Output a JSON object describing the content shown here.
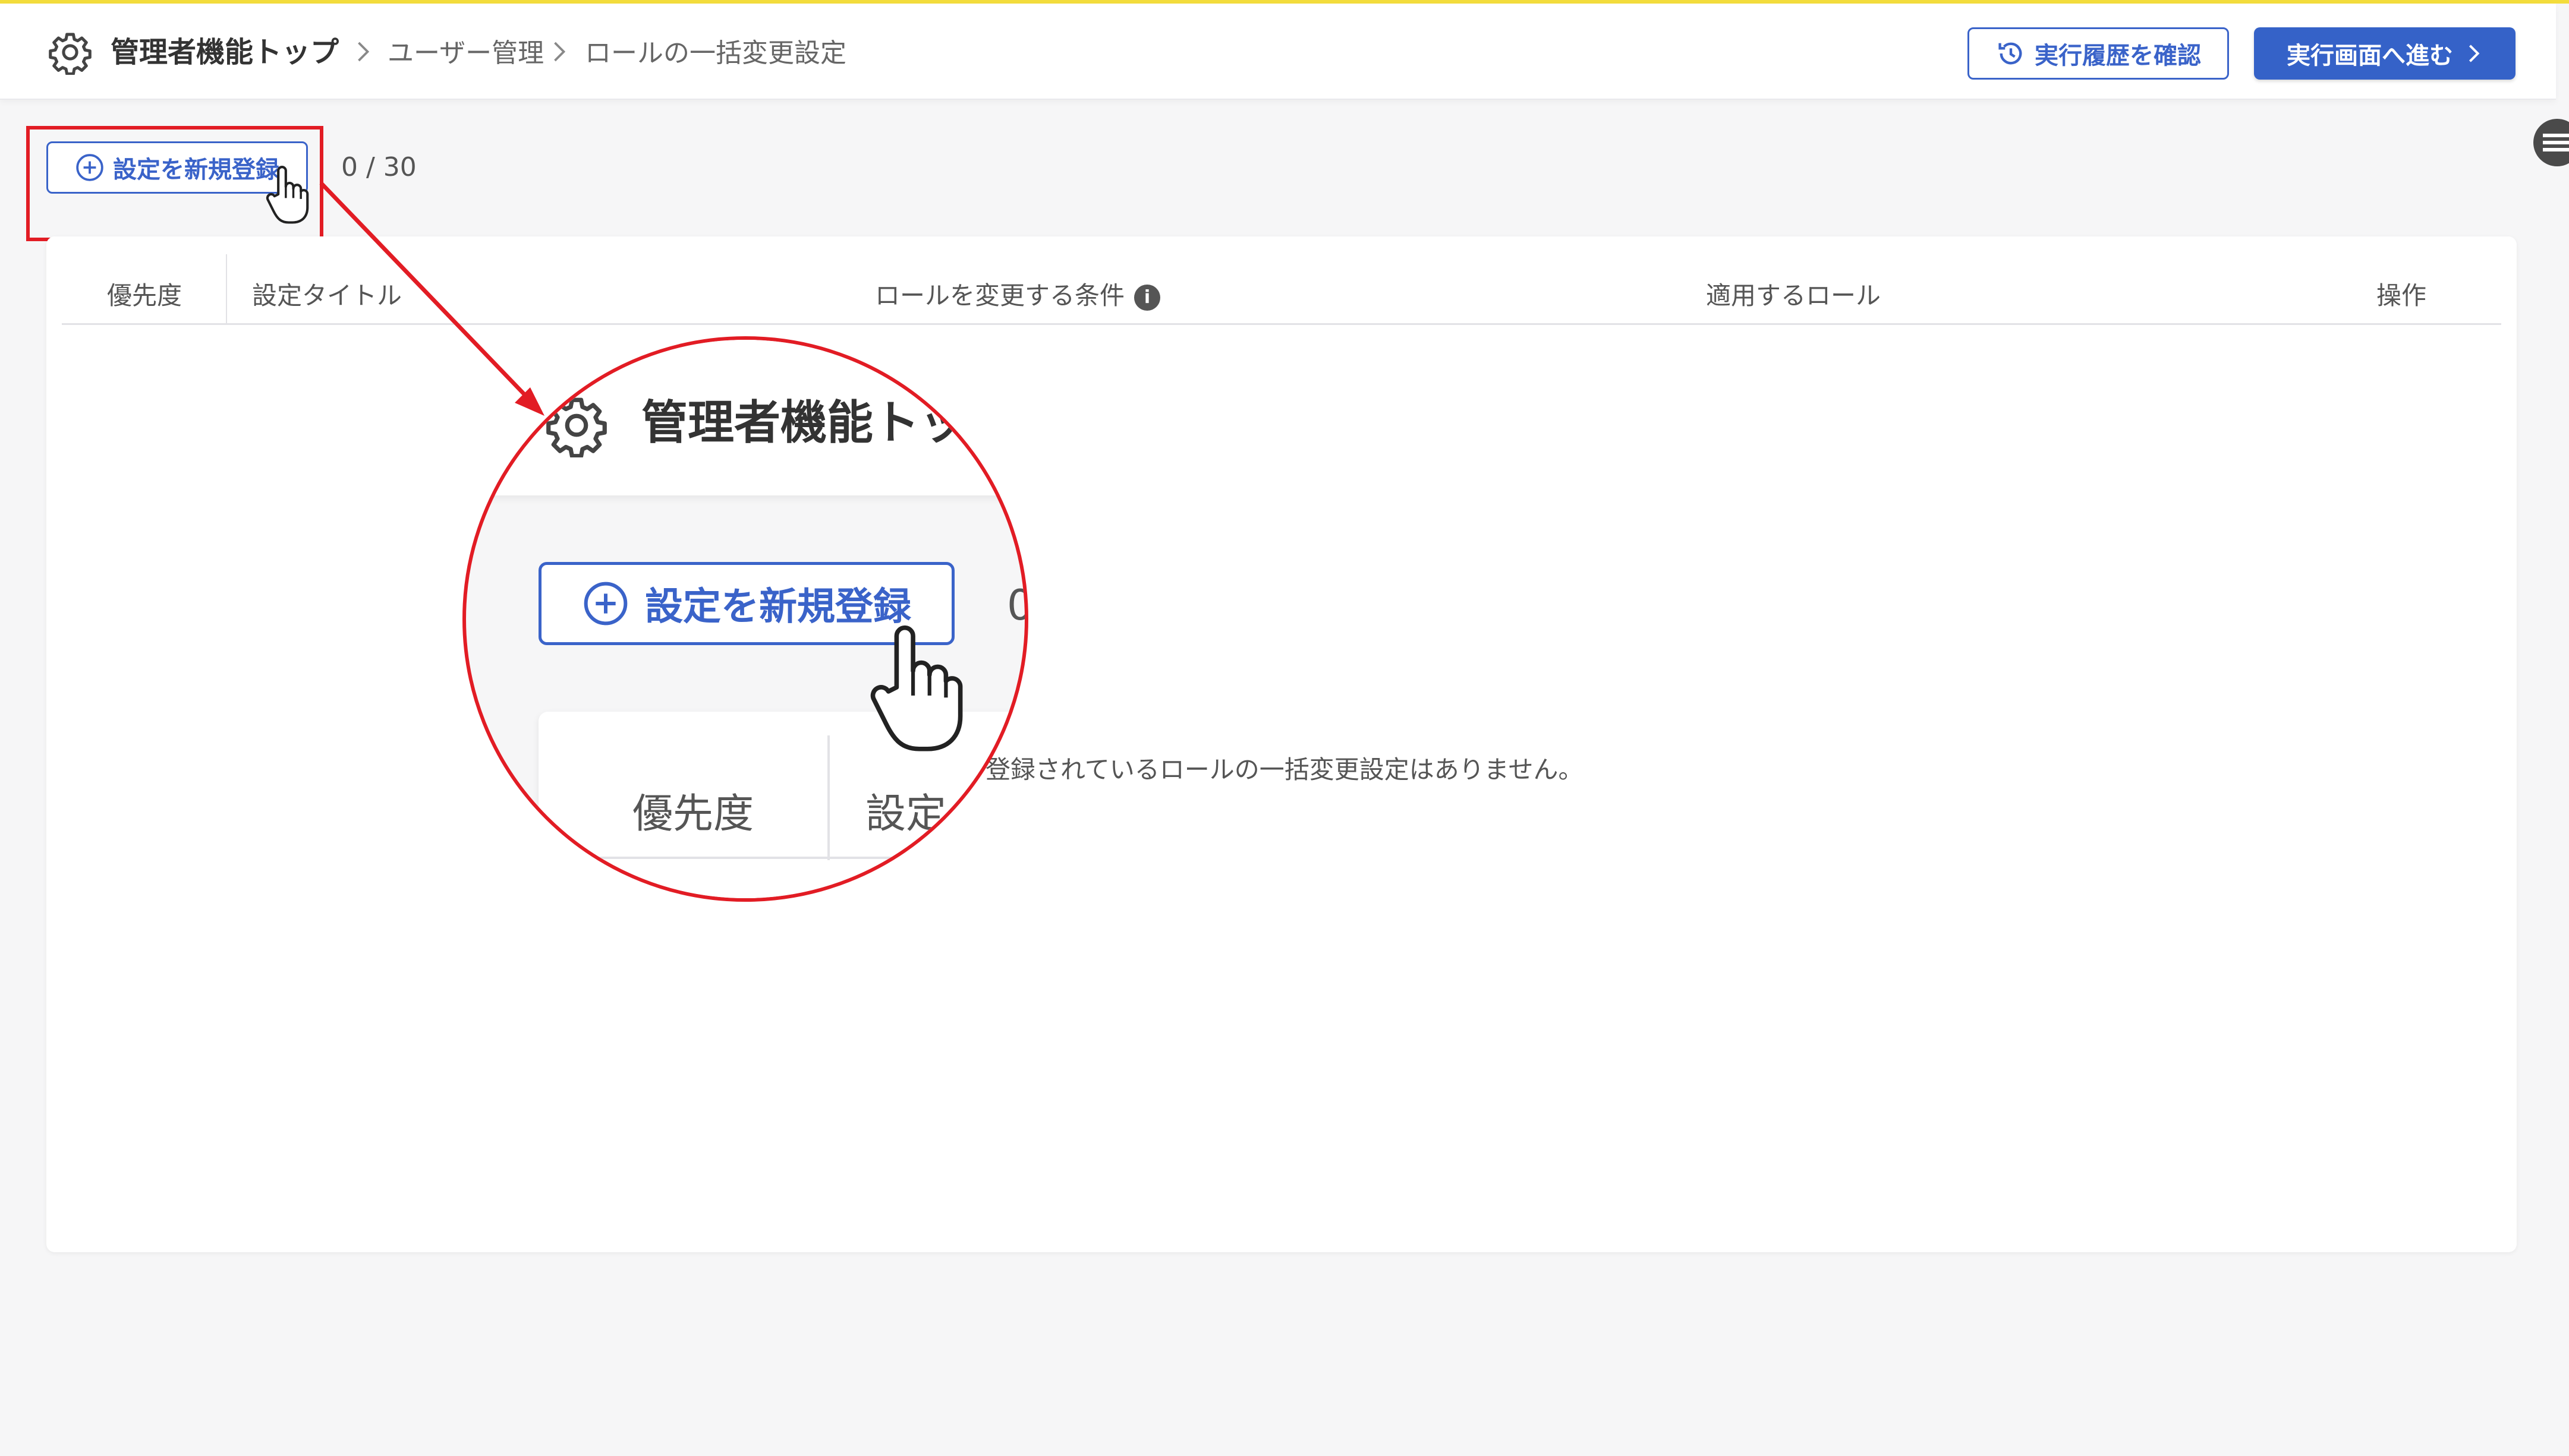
{
  "header": {
    "breadcrumb_root": "管理者機能トップ",
    "breadcrumb_items": [
      "ユーザー管理",
      "ロールの一括変更設定"
    ],
    "history_button": "実行履歴を確認",
    "exec_button": "実行画面へ進む"
  },
  "toolbar": {
    "new_button": "設定を新規登録",
    "counter": "0 / 30"
  },
  "table": {
    "columns": [
      "優先度",
      "設定タイトル",
      "ロールを変更する条件",
      "適用するロール",
      "操作"
    ],
    "empty_message": "登録されているロールの一括変更設定はありません。"
  },
  "zoom": {
    "title": "管理者機能トッ",
    "button": "設定を新規登録",
    "counter_partial": "0",
    "col_priority": "優先度",
    "col_title_partial": "設定タ"
  },
  "colors": {
    "accent": "#3562c8",
    "highlight": "#e21c24",
    "topline": "#f3dc3c"
  }
}
